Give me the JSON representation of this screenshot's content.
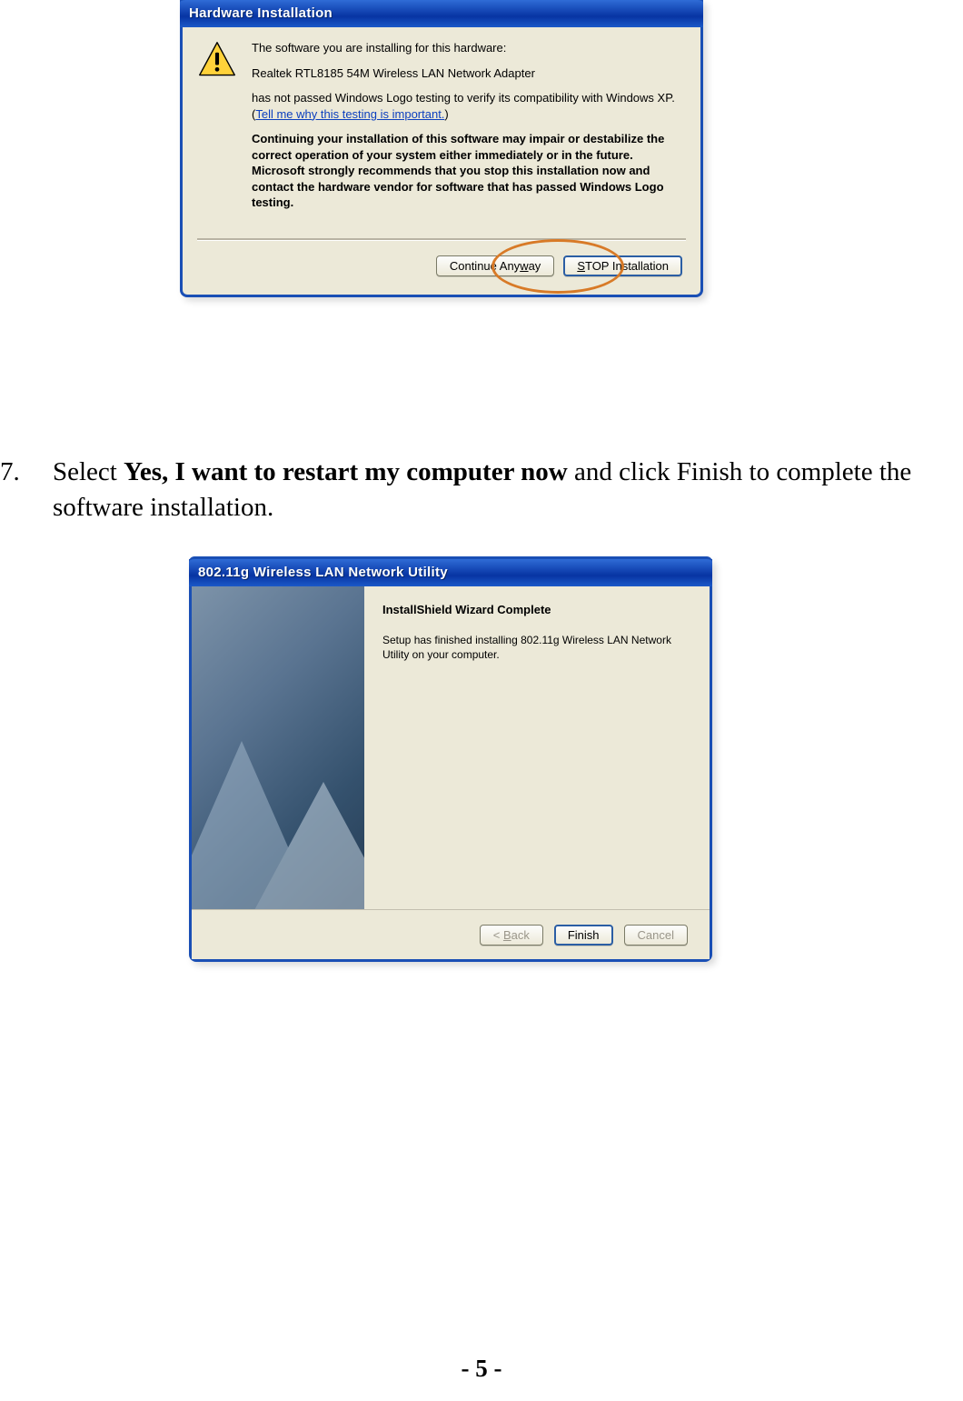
{
  "dlg1": {
    "title": "Hardware Installation",
    "intro": "The software you are installing for this hardware:",
    "device": "Realtek RTL8185 54M Wireless LAN Network Adapter",
    "notPassed1": "has not passed Windows Logo testing to verify its compatibility with Windows XP. (",
    "link": "Tell me why this testing is important.",
    "notPassed2": ")",
    "warning": "Continuing your installation of this software may impair or destabilize the correct operation of your system either immediately or in the future. Microsoft strongly recommends that you stop this installation now and contact the hardware vendor for software that has passed Windows Logo testing.",
    "btnContinuePre": "Continue Any",
    "btnContinueU": "w",
    "btnContinuePost": "ay",
    "btnStopU": "S",
    "btnStopPost": "TOP Installation"
  },
  "step": {
    "num": "7.",
    "preBold": "Select ",
    "bold": "Yes, I want to restart my computer now",
    "postBold": " and click Finish to complete the software installation."
  },
  "dlg2": {
    "title": "802.11g Wireless LAN Network Utility",
    "heading": "InstallShield Wizard Complete",
    "body": "Setup has finished installing 802.11g Wireless LAN Network Utility on your computer.",
    "btnBackPre": "< ",
    "btnBackU": "B",
    "btnBackPost": "ack",
    "btnFinish": "Finish",
    "btnCancel": "Cancel"
  },
  "pageNumber": "- 5 -"
}
